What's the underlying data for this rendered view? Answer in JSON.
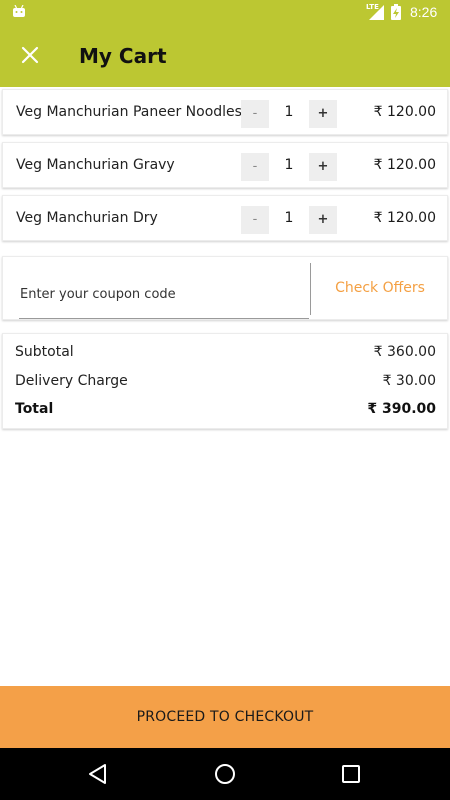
{
  "status_bar": {
    "network": "LTE",
    "time": "8:26"
  },
  "app_bar": {
    "title": "My Cart",
    "close_icon": "close-icon"
  },
  "cart": {
    "items": [
      {
        "name": "Veg Manchurian Paneer Noodles",
        "minus": "-",
        "quantity": "1",
        "plus": "+",
        "price": "₹ 120.00"
      },
      {
        "name": "Veg Manchurian Gravy",
        "minus": "-",
        "quantity": "1",
        "plus": "+",
        "price": "₹ 120.00"
      },
      {
        "name": "Veg Manchurian Dry",
        "minus": "-",
        "quantity": "1",
        "plus": "+",
        "price": "₹ 120.00"
      }
    ]
  },
  "coupon": {
    "placeholder": "Enter your coupon code",
    "value": "",
    "action_label": "Check Offers"
  },
  "summary": {
    "subtotal_label": "Subtotal",
    "subtotal_value": "₹ 360.00",
    "delivery_label": "Delivery Charge",
    "delivery_value": "₹ 30.00",
    "total_label": "Total",
    "total_value": "₹ 390.00"
  },
  "checkout": {
    "label": "PROCEED TO CHECKOUT"
  },
  "nav": {
    "back_icon": "back-icon",
    "home_icon": "home-icon",
    "recents_icon": "recents-icon"
  },
  "colors": {
    "app_bar": "#bcc732",
    "accent": "#f4a048",
    "offers_text": "#f4a043"
  }
}
